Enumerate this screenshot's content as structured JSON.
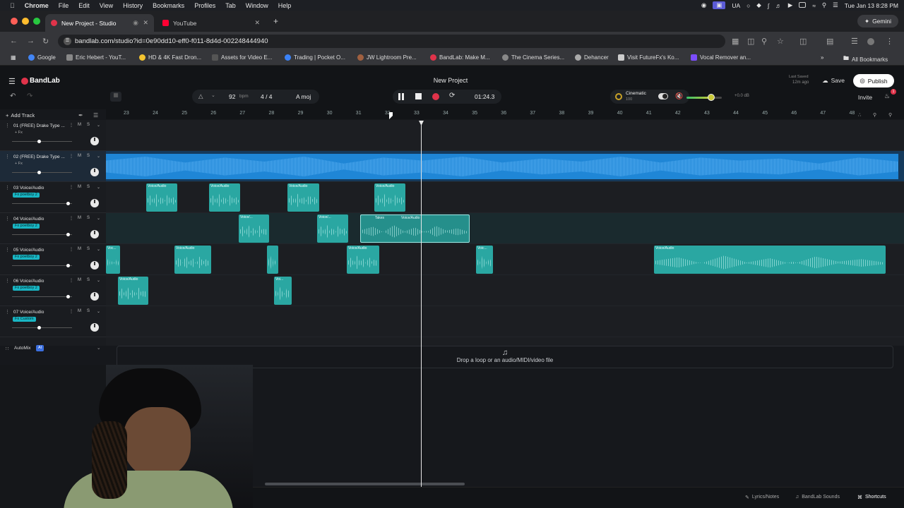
{
  "macbar": {
    "apple": "",
    "app": "Chrome",
    "menus": [
      "File",
      "Edit",
      "View",
      "History",
      "Bookmarks",
      "Profiles",
      "Tab",
      "Window",
      "Help"
    ],
    "ua": "UA",
    "datetime": "Tue Jan 13  8:28 PM",
    "gemini": "Gemini"
  },
  "browser": {
    "tabs": [
      {
        "title": "New Project - Studio",
        "color": "#e0334a"
      },
      {
        "title": "YouTube",
        "color": "#ff0033"
      }
    ],
    "url": "bandlab.com/studio?id=0e90dd10-eff0-f011-8d4d-002248444940",
    "bookmarks": [
      {
        "label": "Google",
        "color": "#4285f4"
      },
      {
        "label": "Eric Hebert - YouT...",
        "color": "#888888"
      },
      {
        "label": "HD & 4K Fast Dron...",
        "color": "#f4c430"
      },
      {
        "label": "Assets for Video E...",
        "color": "#555555"
      },
      {
        "label": "Trading | Pocket O...",
        "color": "#3b82f6"
      },
      {
        "label": "JW Lightroom Pre...",
        "color": "#a06040"
      },
      {
        "label": "BandLab: Make M...",
        "color": "#e0334a"
      },
      {
        "label": "The Cinema Series...",
        "color": "#888888"
      },
      {
        "label": "Dehancer",
        "color": "#aaaaaa"
      },
      {
        "label": "Visit FutureFx's Ko...",
        "color": "#cccccc"
      },
      {
        "label": "Vocal Remover an...",
        "color": "#7c4dff"
      }
    ],
    "all_bookmarks": "All Bookmarks"
  },
  "studio": {
    "brand": "BandLab",
    "project_title": "New Project",
    "last_saved": "Last Saved",
    "saved_ago": "12m ago",
    "save_label": "Save",
    "publish_label": "Publish",
    "invite_label": "Invite",
    "notification_count": "1",
    "bpm_value": "92",
    "bpm_unit": "bpm",
    "time_signature": "4 / 4",
    "key": "A moj",
    "time_display": "01:24.3",
    "preset_name": "Cinematic",
    "preset_value": "100",
    "volume_db": "+0.0 dB",
    "add_track_label": "Add Track",
    "automix_label": "AutoMix",
    "automix_badge": "AI",
    "drop_text": "Drop a loop or an audio/MIDI/video file",
    "footer": {
      "lyrics": "Lyrics/Notes",
      "sounds": "BandLab Sounds",
      "shortcuts": "Shortcuts"
    }
  },
  "ruler": [
    "23",
    "24",
    "25",
    "26",
    "27",
    "28",
    "29",
    "30",
    "31",
    "32",
    "33",
    "34",
    "35",
    "36",
    "37",
    "38",
    "39",
    "40",
    "41",
    "42",
    "43",
    "44",
    "45",
    "46",
    "47",
    "48"
  ],
  "tracks": [
    {
      "name": "01  (FREE) Drake Type ...",
      "fx": "+ Fx",
      "fx_style": "plain",
      "vol_pct": 0.45
    },
    {
      "name": "02  (FREE) Drake Type ...",
      "fx": "+ Fx",
      "fx_style": "plain",
      "vol_pct": 0.45
    },
    {
      "name": "03  Voice/Audio",
      "fx": "Fx  poetboy 2",
      "fx_style": "teal",
      "vol_pct": 0.96
    },
    {
      "name": "04  Voice/Audio",
      "fx": "Fx  poetboy 2",
      "fx_style": "teal",
      "vol_pct": 0.96
    },
    {
      "name": "05  Voice/Audio",
      "fx": "Fx  poetboy 2",
      "fx_style": "teal",
      "vol_pct": 0.96
    },
    {
      "name": "06  Voice/Audio",
      "fx": "Fx  poetboy 2",
      "fx_style": "teal",
      "vol_pct": 0.96
    },
    {
      "name": "07  Voice/Audio",
      "fx": "Fx  Custom",
      "fx_style": "teal",
      "vol_pct": 0.45
    }
  ],
  "clip_labels": {
    "voice": "Voice/Audio",
    "voice_short": "Voice/...",
    "voic": "Voic...",
    "voi": "Voi...",
    "voc": "Voc...",
    "takes": "Takes"
  },
  "colors": {
    "accent": "#e0334a",
    "clip": "#2aa7a2",
    "beat": "#1f86d6",
    "fx_badge": "#19b6c4"
  }
}
